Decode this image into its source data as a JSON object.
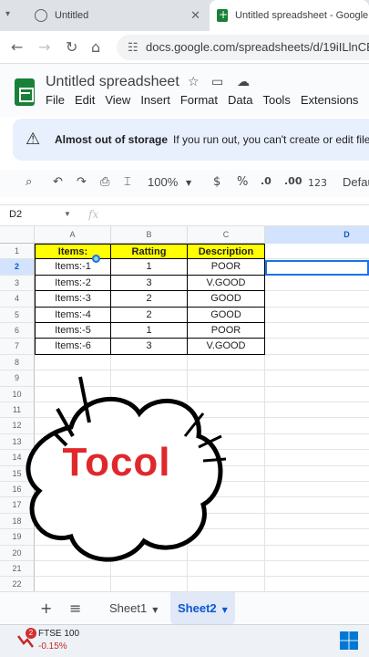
{
  "browser": {
    "tabs": [
      {
        "title": "Untitled",
        "close": "✕"
      },
      {
        "title": "Untitled spreadsheet - Google",
        "close": "✕"
      }
    ],
    "url": "docs.google.com/spreadsheets/d/19iILlnCBft53"
  },
  "doc": {
    "title": "Untitled spreadsheet",
    "menu": [
      "File",
      "Edit",
      "View",
      "Insert",
      "Format",
      "Data",
      "Tools",
      "Extensions"
    ]
  },
  "banner": {
    "title": "Almost out of storage",
    "message": "If you run out, you can't create or edit files"
  },
  "toolbar": {
    "zoom": "100%",
    "currency": "$",
    "percent": "%",
    "dec_decrease": ".0",
    "dec_increase": ".00",
    "number_format": "123",
    "font": "Default"
  },
  "formula_bar": {
    "cell_ref": "D2",
    "fx": "fx"
  },
  "grid": {
    "columns": [
      "A",
      "B",
      "C",
      "D"
    ],
    "rows": [
      "1",
      "2",
      "3",
      "4",
      "5",
      "6",
      "7",
      "8",
      "9",
      "10",
      "11",
      "12",
      "13",
      "14",
      "15",
      "16",
      "17",
      "18",
      "19",
      "20",
      "21",
      "22"
    ],
    "selected_row": "2",
    "selected_col": "D",
    "header": [
      "Items:",
      "Ratting",
      "Description"
    ],
    "data": [
      [
        "Items:-1",
        "1",
        "POOR"
      ],
      [
        "Items:-2",
        "3",
        "V.GOOD"
      ],
      [
        "Items:-3",
        "2",
        "GOOD"
      ],
      [
        "Items:-4",
        "2",
        "GOOD"
      ],
      [
        "Items:-5",
        "1",
        "POOR"
      ],
      [
        "Items:-6",
        "3",
        "V.GOOD"
      ]
    ]
  },
  "overlay": {
    "text": "Tocol"
  },
  "sheets": {
    "add": "+",
    "list": "≡",
    "tabs": [
      "Sheet1",
      "Sheet2"
    ],
    "active": "Sheet2"
  },
  "taskbar": {
    "stock_name": "FTSE 100",
    "stock_change": "-0.15%",
    "badge": "2",
    "down_color": "#c62828"
  }
}
